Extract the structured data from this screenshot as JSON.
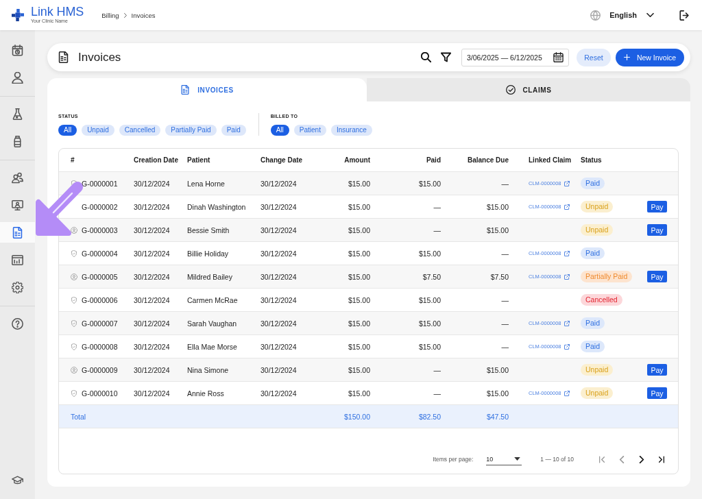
{
  "app": {
    "name": "Link HMS",
    "clinic_name": "Your Clinic Name"
  },
  "breadcrumb": [
    "Billing",
    "Invoices"
  ],
  "language": {
    "label": "English"
  },
  "sidebar": {
    "groups": [
      {
        "items": [
          {
            "kind": "calendar",
            "selected": false
          },
          {
            "kind": "person",
            "selected": false
          }
        ]
      },
      {
        "items": [
          {
            "kind": "flask",
            "selected": false
          },
          {
            "kind": "bottle",
            "selected": false
          }
        ]
      },
      {
        "items": [
          {
            "kind": "people",
            "selected": false
          },
          {
            "kind": "monitor",
            "selected": false
          },
          {
            "kind": "document",
            "selected": true
          },
          {
            "kind": "chart",
            "selected": false
          },
          {
            "kind": "gear",
            "selected": false
          }
        ]
      },
      {
        "items": [
          {
            "kind": "help",
            "selected": false
          }
        ]
      }
    ],
    "bottom_items": [
      {
        "kind": "cap",
        "selected": false
      }
    ]
  },
  "page_header": {
    "title": "Invoices",
    "date_range": "3/06/2025 — 6/12/2025",
    "buttons": [
      {
        "label": "Reset",
        "kind": "secondary"
      },
      {
        "label": "New Invoice",
        "kind": "primary"
      }
    ]
  },
  "tabs": [
    {
      "label": "INVOICES",
      "kind": "document",
      "selected": true
    },
    {
      "label": "CLAIMS",
      "kind": "check",
      "selected": false
    }
  ],
  "filters": [
    {
      "label": "STATUS",
      "options": [
        {
          "label": "All",
          "selected": true
        },
        {
          "label": "Unpaid",
          "selected": false
        },
        {
          "label": "Cancelled",
          "selected": false
        },
        {
          "label": "Partially Paid",
          "selected": false
        },
        {
          "label": "Paid",
          "selected": false
        }
      ]
    },
    {
      "label": "BILLED TO",
      "options": [
        {
          "label": "All",
          "selected": true
        },
        {
          "label": "Patient",
          "selected": false
        },
        {
          "label": "Insurance",
          "selected": false
        }
      ]
    }
  ],
  "table": {
    "columns": [
      "#",
      "Creation Date",
      "Patient",
      "Change Date",
      "Amount",
      "Paid",
      "Balance Due",
      "Linked Claim",
      "Status"
    ],
    "rows": [
      {
        "kind": "insurance",
        "number": "G-0000001",
        "creation_date": "30/12/2024",
        "patient": "Lena Horne",
        "change_date": "30/12/2024",
        "amount": "$15.00",
        "paid": "$15.00",
        "balance_due": "—",
        "linked_claim": "CLM-0000008",
        "status": {
          "label": "Paid",
          "kind": "paid"
        }
      },
      {
        "number": "G-0000002",
        "creation_date": "30/12/2024",
        "patient": "Dinah Washington",
        "change_date": "30/12/2024",
        "amount": "$15.00",
        "paid": "—",
        "balance_due": "$15.00",
        "linked_claim": "CLM-0000008",
        "status": {
          "label": "Unpaid",
          "kind": "unpaid"
        },
        "action": "Pay"
      },
      {
        "kind": "patient",
        "number": "G-0000003",
        "creation_date": "30/12/2024",
        "patient": "Bessie Smith",
        "change_date": "30/12/2024",
        "amount": "$15.00",
        "paid": "—",
        "balance_due": "$15.00",
        "status": {
          "label": "Unpaid",
          "kind": "unpaid"
        },
        "action": "Pay"
      },
      {
        "kind": "insurance",
        "number": "G-0000004",
        "creation_date": "30/12/2024",
        "patient": "Billie Holiday",
        "change_date": "30/12/2024",
        "amount": "$15.00",
        "paid": "$15.00",
        "balance_due": "—",
        "linked_claim": "CLM-0000008",
        "status": {
          "label": "Paid",
          "kind": "paid"
        }
      },
      {
        "kind": "patient",
        "number": "G-0000005",
        "creation_date": "30/12/2024",
        "patient": "Mildred Bailey",
        "change_date": "30/12/2024",
        "amount": "$15.00",
        "paid": "$7.50",
        "balance_due": "$7.50",
        "linked_claim": "CLM-0000008",
        "status": {
          "label": "Partially Paid",
          "kind": "partial"
        },
        "action": "Pay"
      },
      {
        "kind": "insurance",
        "number": "G-0000006",
        "creation_date": "30/12/2024",
        "patient": "Carmen McRae",
        "change_date": "30/12/2024",
        "amount": "$15.00",
        "paid": "$15.00",
        "balance_due": "—",
        "status": {
          "label": "Cancelled",
          "kind": "cancelled"
        }
      },
      {
        "kind": "insurance",
        "number": "G-0000007",
        "creation_date": "30/12/2024",
        "patient": "Sarah Vaughan",
        "change_date": "30/12/2024",
        "amount": "$15.00",
        "paid": "$15.00",
        "balance_due": "—",
        "linked_claim": "CLM-0000008",
        "status": {
          "label": "Paid",
          "kind": "paid"
        }
      },
      {
        "kind": "insurance",
        "number": "G-0000008",
        "creation_date": "30/12/2024",
        "patient": "Ella Mae Morse",
        "change_date": "30/12/2024",
        "amount": "$15.00",
        "paid": "$15.00",
        "balance_due": "—",
        "linked_claim": "CLM-0000008",
        "status": {
          "label": "Paid",
          "kind": "paid"
        }
      },
      {
        "kind": "patient",
        "number": "G-0000009",
        "creation_date": "30/12/2024",
        "patient": "Nina Simone",
        "change_date": "30/12/2024",
        "amount": "$15.00",
        "paid": "—",
        "balance_due": "$15.00",
        "status": {
          "label": "Unpaid",
          "kind": "unpaid"
        },
        "action": "Pay"
      },
      {
        "kind": "insurance",
        "number": "G-0000010",
        "creation_date": "30/12/2024",
        "patient": "Annie Ross",
        "change_date": "30/12/2024",
        "amount": "$15.00",
        "paid": "—",
        "balance_due": "$15.00",
        "linked_claim": "CLM-0000008",
        "status": {
          "label": "Unpaid",
          "kind": "unpaid"
        },
        "action": "Pay"
      }
    ],
    "totals": {
      "label": "Total",
      "amount": "$150.00",
      "paid": "$82.50",
      "balance_due": "$47.50"
    }
  },
  "pagination": {
    "items_per_page_label": "Items per page:",
    "page_size": "10",
    "range": "1 — 10 of 10",
    "buttons": [
      {
        "kind": "first",
        "disabled": true
      },
      {
        "kind": "previous",
        "disabled": true
      },
      {
        "kind": "next",
        "disabled": false
      },
      {
        "kind": "last",
        "disabled": false
      }
    ]
  },
  "annotation": {
    "kind": "arrow"
  }
}
